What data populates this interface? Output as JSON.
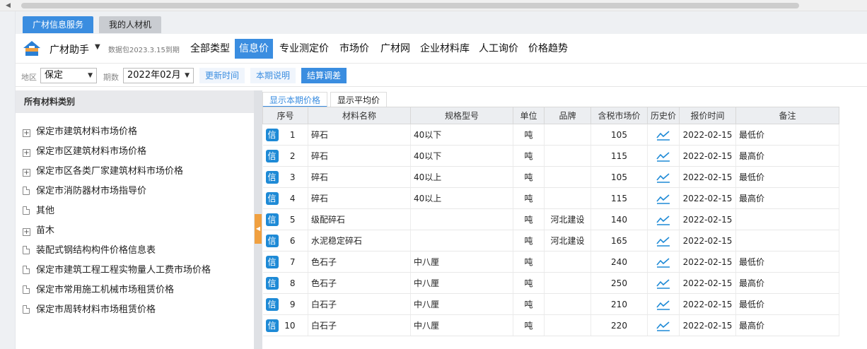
{
  "tabs": {
    "primary": "广材信息服务",
    "secondary": "我的人材机"
  },
  "toolbar": {
    "brand": "广材助手",
    "package_info": "数据包2023.3.15到期",
    "nav": [
      "全部类型",
      "信息价",
      "专业测定价",
      "市场价",
      "广材网",
      "企业材料库",
      "人工询价",
      "价格趋势"
    ],
    "active_nav": "信息价"
  },
  "filters": {
    "region_label": "地区",
    "region_value": "保定",
    "period_label": "期数",
    "period_value": "2022年02月",
    "update_time": "更新时间",
    "period_note": "本期说明",
    "settlement": "结算调差"
  },
  "left_panel": {
    "title": "所有材料类别",
    "items": [
      {
        "label": "保定市建筑材料市场价格",
        "icon": "expand-icon"
      },
      {
        "label": "保定市区建筑材料市场价格",
        "icon": "expand-icon"
      },
      {
        "label": "保定市区各类厂家建筑材料市场价格",
        "icon": "expand-icon"
      },
      {
        "label": "保定市消防器材市场指导价",
        "icon": "document-icon"
      },
      {
        "label": "其他",
        "icon": "document-icon"
      },
      {
        "label": "苗木",
        "icon": "expand-icon"
      },
      {
        "label": "装配式钢结构构件价格信息表",
        "icon": "document-icon"
      },
      {
        "label": "保定市建筑工程工程实物量人工费市场价格",
        "icon": "document-icon"
      },
      {
        "label": "保定市常用施工机械市场租赁价格",
        "icon": "document-icon"
      },
      {
        "label": "保定市周转材料市场租赁价格",
        "icon": "document-icon"
      }
    ]
  },
  "right_panel": {
    "subtabs": [
      "显示本期价格",
      "显示平均价"
    ],
    "columns": [
      "序号",
      "材料名称",
      "规格型号",
      "单位",
      "品牌",
      "含税市场价",
      "历史价",
      "报价时间",
      "备注"
    ],
    "badge": "信",
    "rows": [
      {
        "no": "1",
        "name": "碎石",
        "spec": "40以下",
        "unit": "吨",
        "brand": "",
        "price": "105",
        "date": "2022-02-15",
        "note": "最低价"
      },
      {
        "no": "2",
        "name": "碎石",
        "spec": "40以下",
        "unit": "吨",
        "brand": "",
        "price": "115",
        "date": "2022-02-15",
        "note": "最高价"
      },
      {
        "no": "3",
        "name": "碎石",
        "spec": "40以上",
        "unit": "吨",
        "brand": "",
        "price": "105",
        "date": "2022-02-15",
        "note": "最低价"
      },
      {
        "no": "4",
        "name": "碎石",
        "spec": "40以上",
        "unit": "吨",
        "brand": "",
        "price": "115",
        "date": "2022-02-15",
        "note": "最高价"
      },
      {
        "no": "5",
        "name": "级配碎石",
        "spec": "",
        "unit": "吨",
        "brand": "河北建设",
        "price": "140",
        "date": "2022-02-15",
        "note": ""
      },
      {
        "no": "6",
        "name": "水泥稳定碎石",
        "spec": "",
        "unit": "吨",
        "brand": "河北建设",
        "price": "165",
        "date": "2022-02-15",
        "note": ""
      },
      {
        "no": "7",
        "name": "色石子",
        "spec": "中八厘",
        "unit": "吨",
        "brand": "",
        "price": "240",
        "date": "2022-02-15",
        "note": "最低价"
      },
      {
        "no": "8",
        "name": "色石子",
        "spec": "中八厘",
        "unit": "吨",
        "brand": "",
        "price": "250",
        "date": "2022-02-15",
        "note": "最高价"
      },
      {
        "no": "9",
        "name": "白石子",
        "spec": "中八厘",
        "unit": "吨",
        "brand": "",
        "price": "210",
        "date": "2022-02-15",
        "note": "最低价"
      },
      {
        "no": "10",
        "name": "白石子",
        "spec": "中八厘",
        "unit": "吨",
        "brand": "",
        "price": "220",
        "date": "2022-02-15",
        "note": "最高价"
      }
    ]
  },
  "colors": {
    "accent": "#3a8de0",
    "badge": "#1e8ad6",
    "splitter_handle": "#f0a040"
  }
}
